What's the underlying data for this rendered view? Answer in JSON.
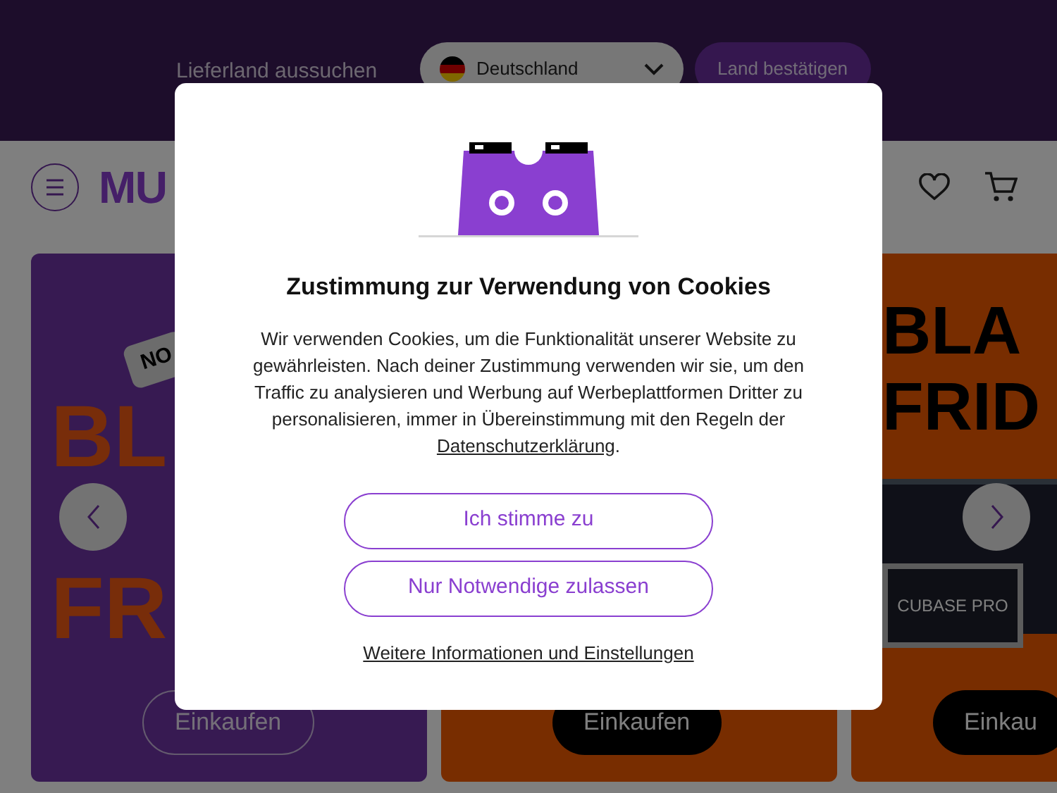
{
  "country_bar": {
    "label": "Lieferland aussuchen",
    "country_select": {
      "value": "Deutschland"
    },
    "confirm_button": "Land bestätigen"
  },
  "header": {
    "logo": "MU"
  },
  "banners": [
    {
      "kind": "purple",
      "badge": "NO",
      "headline": [
        "BL",
        "FR"
      ],
      "button": "Einkaufen"
    },
    {
      "kind": "orange",
      "button": "Einkaufen"
    },
    {
      "kind": "product",
      "headline": [
        "BLA",
        "FRID"
      ],
      "product_label": "CUBASE PRO",
      "button": "Einkau"
    }
  ],
  "cookie_dialog": {
    "title": "Zustimmung zur Verwendung von Cookies",
    "text": "Wir verwenden Cookies, um die Funktionalität unserer Website zu gewährleisten. Nach deiner Zustimmung verwenden wir sie, um den Traffic zu analysieren und Werbung auf Werbeplattformen Dritter zu personalisieren, immer in Übereinstimmung mit den Regeln der",
    "link": "Datenschutzerklärung",
    "text_end": ".",
    "buttons": [
      "Ich stimme zu",
      "Nur Notwendige zulassen"
    ],
    "more_link": "Weitere Informationen und Einstellungen"
  }
}
